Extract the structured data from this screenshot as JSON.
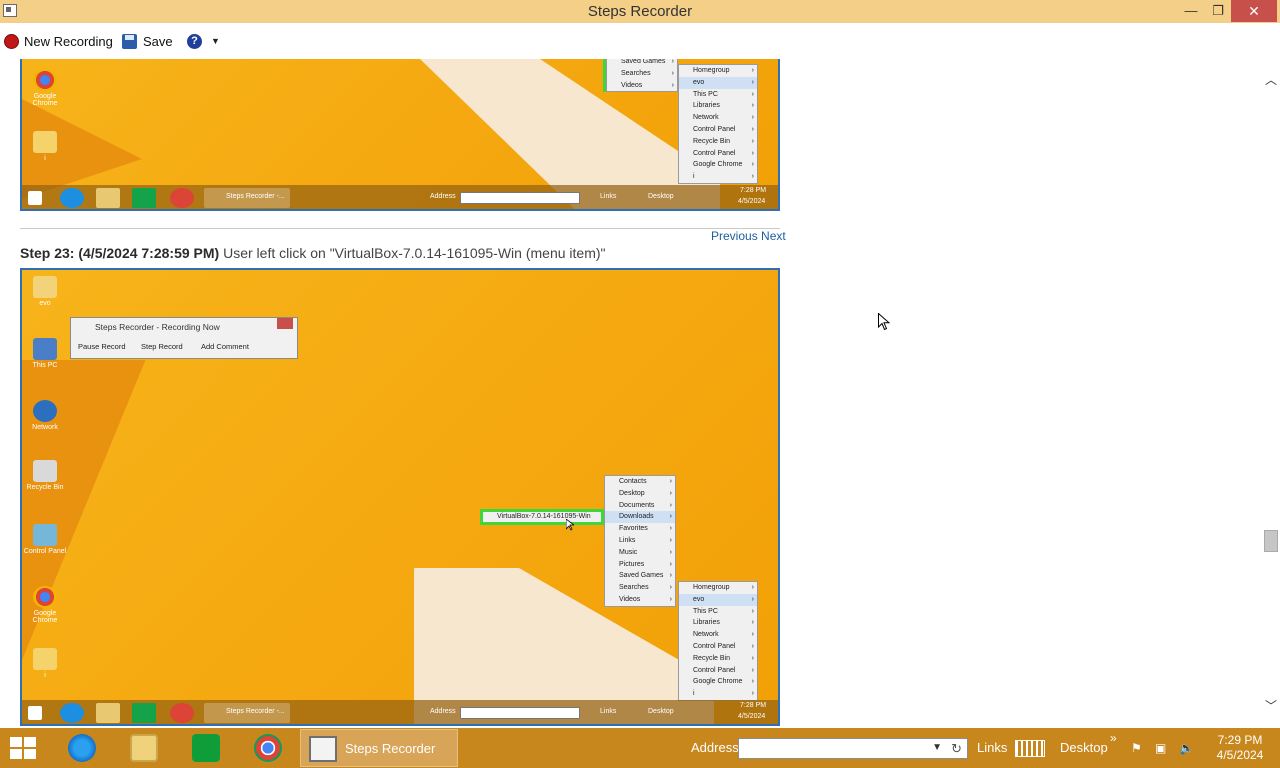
{
  "window": {
    "title": "Steps Recorder",
    "controls": {
      "minimize": "—",
      "restore": "❐",
      "close": "✕"
    }
  },
  "toolbar": {
    "new_recording_label": "New Recording",
    "save_label": "Save"
  },
  "steps": {
    "previous_label": "Previous",
    "next_label": "Next",
    "step23": {
      "heading": "Step 23: (4/5/2024 7:28:59 PM)",
      "description": " User left click on \"VirtualBox-7.0.14-161095-Win (menu item)\""
    }
  },
  "screenshot_top": {
    "desktop_icons": [
      "Google Chrome",
      "i"
    ],
    "menu_items": [
      "Homegroup",
      "evo",
      "This PC",
      "Libraries",
      "Network",
      "Control Panel",
      "Recycle Bin",
      "Control Panel",
      "Google Chrome",
      "i"
    ],
    "selected_menu_item": "evo",
    "upper_menu_items": [
      "Saved Games",
      "Searches",
      "Videos"
    ],
    "taskbar": {
      "window_label": "Steps Recorder -...",
      "address_label": "Address",
      "links_label": "Links",
      "desktop_label": "Desktop",
      "time": "7:28 PM",
      "date": "4/5/2024"
    }
  },
  "screenshot_main": {
    "desktop_icons": [
      "evo",
      "This PC",
      "Network",
      "Recycle Bin",
      "Control Panel",
      "Google Chrome",
      "i"
    ],
    "recorder_window": {
      "title": "Steps Recorder - Recording Now",
      "pause_label": "Pause Record",
      "step_label": "Step Record",
      "comment_label": "Add Comment"
    },
    "highlight_item": "VirtualBox-7.0.14-161095-Win",
    "submenu_items": [
      "Contacts",
      "Desktop",
      "Documents",
      "Downloads",
      "Favorites",
      "Links",
      "Music",
      "Pictures",
      "Saved Games",
      "Searches",
      "Videos"
    ],
    "selected_submenu_item": "Downloads",
    "menu_items": [
      "Homegroup",
      "evo",
      "This PC",
      "Libraries",
      "Network",
      "Control Panel",
      "Recycle Bin",
      "Control Panel",
      "Google Chrome",
      "i"
    ],
    "selected_menu_item": "evo",
    "taskbar": {
      "window_label": "Steps Recorder -...",
      "address_label": "Address",
      "links_label": "Links",
      "desktop_label": "Desktop",
      "time": "7:28 PM",
      "date": "4/5/2024"
    }
  },
  "taskbar": {
    "active_app_label": "Steps Recorder",
    "address_label": "Address",
    "address_value": "",
    "links_label": "Links",
    "desktop_label": "Desktop",
    "overflow": "»",
    "time": "7:29 PM",
    "date": "4/5/2024"
  },
  "colors": {
    "titlebar": "#f3cf87",
    "taskbar": "#c8871d",
    "accent_link": "#1c5f9a",
    "screenshot_border": "#2e6fb5",
    "highlight_green": "#3dd63d"
  }
}
